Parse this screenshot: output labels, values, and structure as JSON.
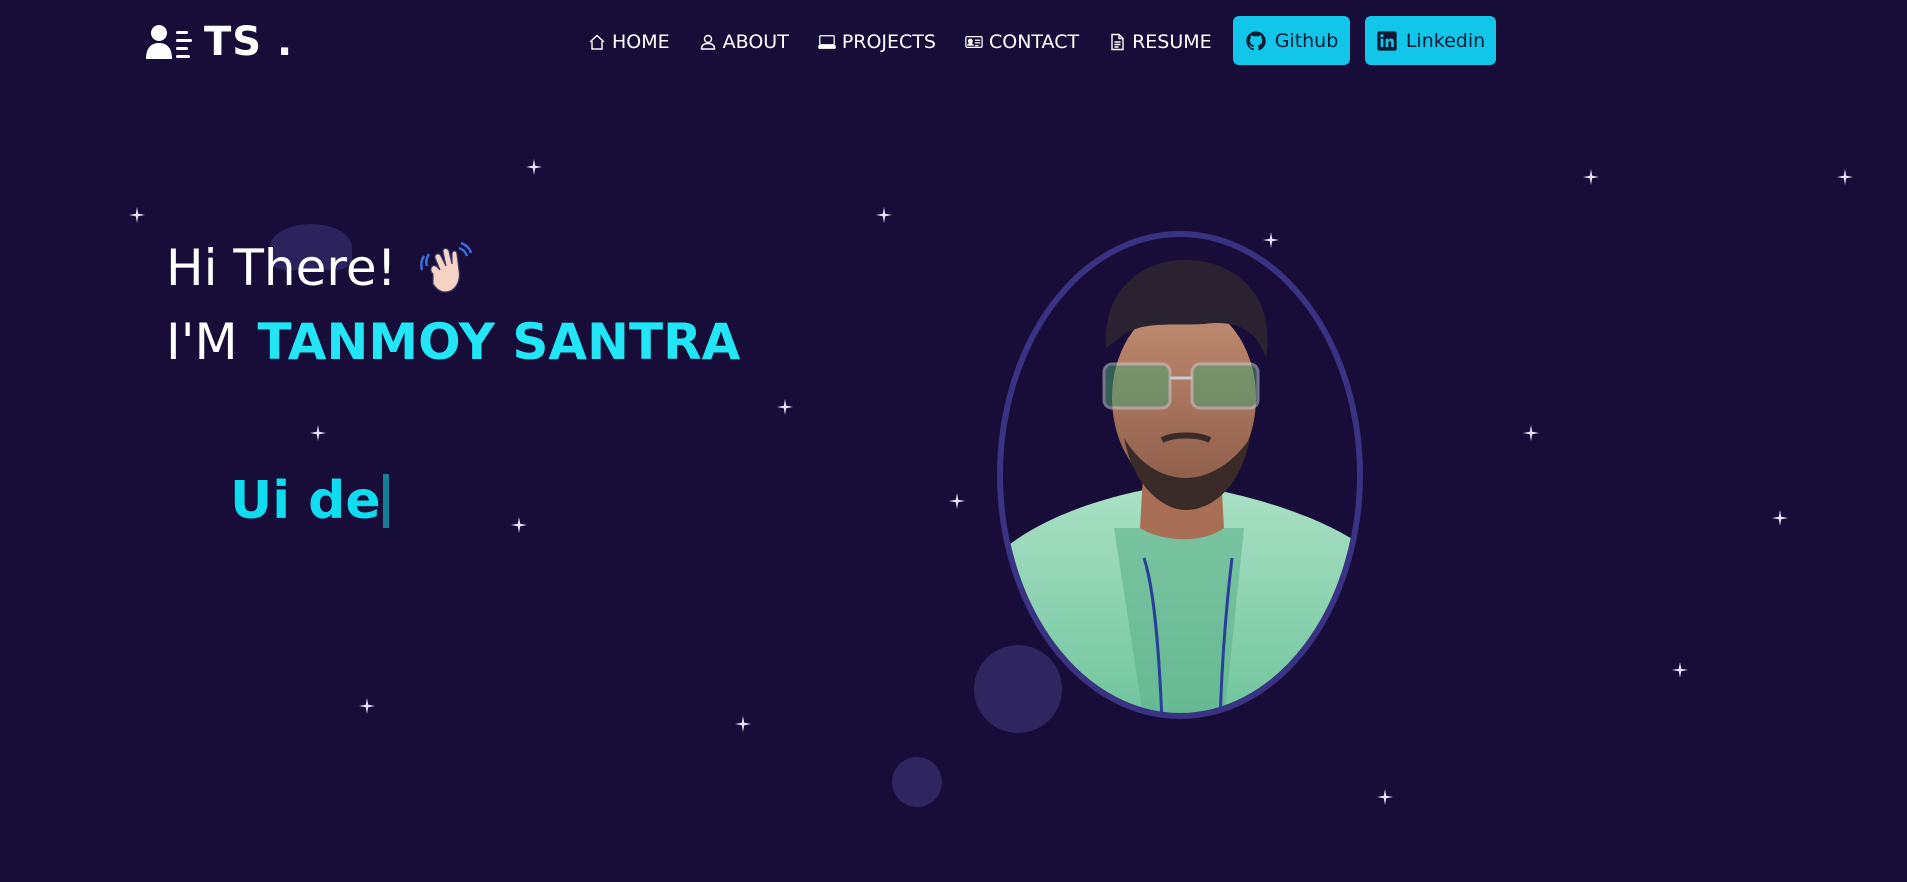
{
  "brand": {
    "text": "TS .",
    "icon": "user-list-icon"
  },
  "nav": {
    "items": [
      {
        "label": "HOME",
        "icon": "home-icon"
      },
      {
        "label": "ABOUT",
        "icon": "user-icon"
      },
      {
        "label": "PROJECTS",
        "icon": "laptop-icon"
      },
      {
        "label": "CONTACT",
        "icon": "contact-card-icon"
      },
      {
        "label": "RESUME",
        "icon": "document-icon"
      }
    ],
    "github_label": "Github",
    "linkedin_label": "Linkedin"
  },
  "hero": {
    "greeting": "Hi There!",
    "intro_prefix": "I'M",
    "name": "TANMOY SANTRA",
    "typed_text": "Ui de"
  },
  "colors": {
    "background": "#170d38",
    "accent": "#12c6e9",
    "name": "#22e6f5",
    "typed": "#10dcf0"
  }
}
